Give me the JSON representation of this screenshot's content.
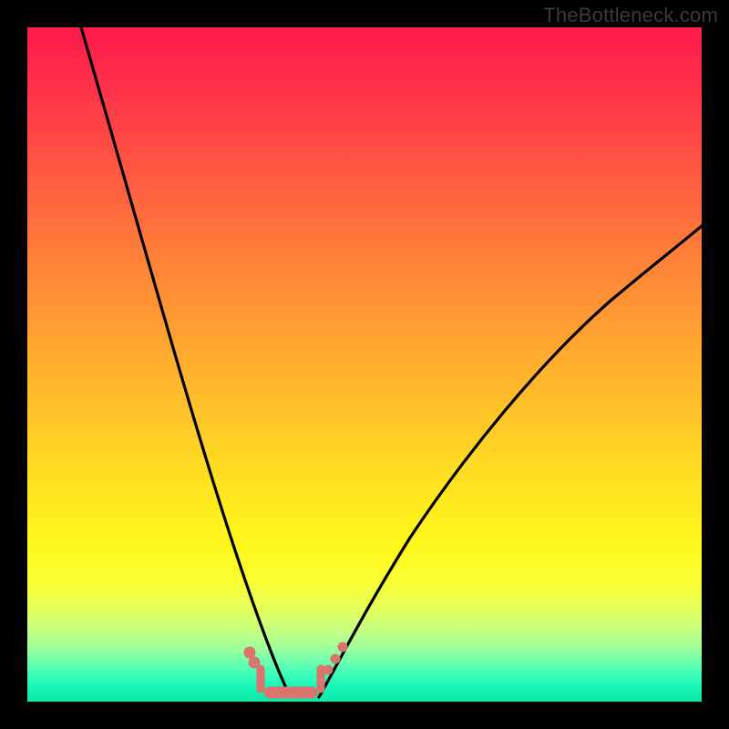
{
  "watermark": "TheBottleneck.com",
  "chart_data": {
    "type": "line",
    "title": "",
    "xlabel": "",
    "ylabel": "",
    "xlim": [
      0,
      100
    ],
    "ylim": [
      0,
      100
    ],
    "grid": false,
    "series": [
      {
        "name": "left-curve",
        "x": [
          8,
          12,
          16,
          20,
          24,
          27,
          29,
          31,
          33,
          34.5,
          36,
          37.5,
          39
        ],
        "y": [
          100,
          80,
          58,
          40,
          26,
          16,
          10,
          6,
          3.5,
          2.5,
          1.8,
          1.2,
          1
        ]
      },
      {
        "name": "right-curve",
        "x": [
          43,
          45,
          47,
          50,
          54,
          60,
          68,
          78,
          90,
          100
        ],
        "y": [
          1,
          2,
          4,
          8,
          14,
          23,
          35,
          48,
          61,
          72
        ]
      },
      {
        "name": "marker-band",
        "x": [
          33,
          34,
          35,
          36,
          37,
          38,
          39,
          40,
          41,
          42,
          43,
          44,
          45,
          46,
          47
        ],
        "y": [
          6,
          4.2,
          2.8,
          1.8,
          1.2,
          1,
          1,
          1,
          1,
          1,
          1.2,
          1.8,
          2.8,
          4.2,
          6
        ]
      }
    ],
    "gradient_stops": [
      {
        "pos": 0,
        "color": "#ff1a4a"
      },
      {
        "pos": 50,
        "color": "#ffb82c"
      },
      {
        "pos": 80,
        "color": "#fff81c"
      },
      {
        "pos": 100,
        "color": "#0ee6a8"
      }
    ]
  }
}
